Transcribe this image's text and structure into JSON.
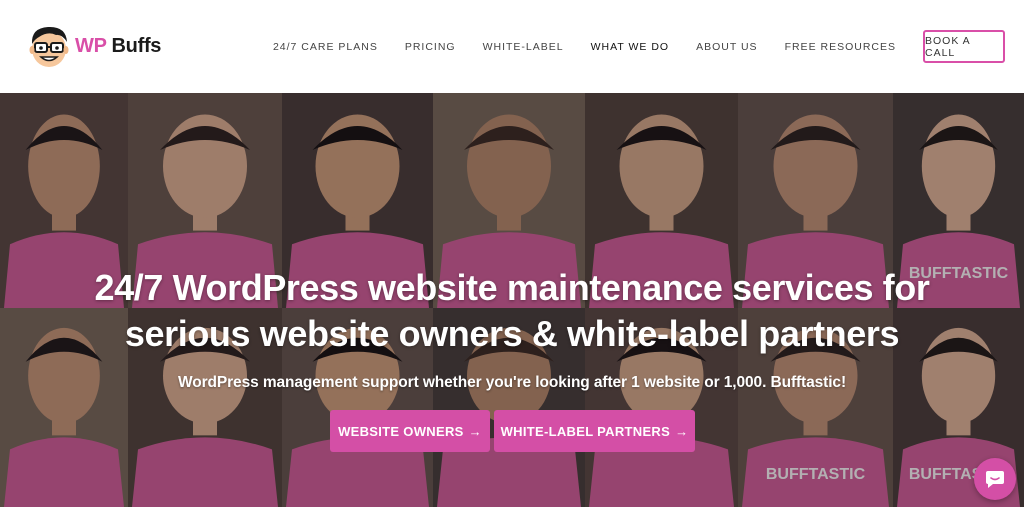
{
  "brand": {
    "name_part1": "WP",
    "name_part2": "Buffs",
    "accent_color": "#d94fa8"
  },
  "nav": {
    "items": [
      {
        "label": "24/7 CARE PLANS",
        "active": false
      },
      {
        "label": "PRICING",
        "active": false
      },
      {
        "label": "WHITE-LABEL",
        "active": false
      },
      {
        "label": "WHAT WE DO",
        "active": true
      },
      {
        "label": "ABOUT US",
        "active": false
      },
      {
        "label": "FREE RESOURCES",
        "active": false
      }
    ],
    "cta_label": "BOOK A CALL"
  },
  "hero": {
    "headline_line1": "24/7 WordPress website maintenance services for",
    "headline_line2": "serious website owners & white-label partners",
    "subheadline": "WordPress management support whether you're looking after 1 website or 1,000. Bufftastic!",
    "primary_cta_label": "WEBSITE OWNERS",
    "secondary_cta_label": "WHITE-LABEL PARTNERS",
    "cta_arrow": "→",
    "shirt_text": "BUFFTASTIC",
    "button_color": "#d44fa6"
  },
  "chat": {
    "icon": "chat-bubble-icon"
  }
}
